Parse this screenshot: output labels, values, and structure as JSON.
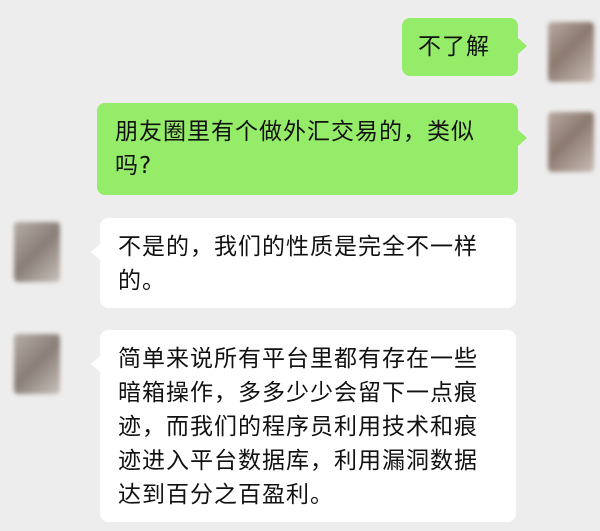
{
  "messages": [
    {
      "side": "sent",
      "text": "不了解"
    },
    {
      "side": "sent",
      "text": "朋友圈里有个做外汇交易的，类似吗?"
    },
    {
      "side": "received",
      "text": "不是的，我们的性质是完全不一样的。"
    },
    {
      "side": "received",
      "text": "简单来说所有平台里都有存在一些暗箱操作，多多少少会留下一点痕迹，而我们的程序员利用技术和痕迹进入平台数据库，利用漏洞数据达到百分之百盈利。"
    }
  ],
  "colors": {
    "sent_bubble": "#95ec69",
    "received_bubble": "#ffffff",
    "background": "#ededed"
  }
}
